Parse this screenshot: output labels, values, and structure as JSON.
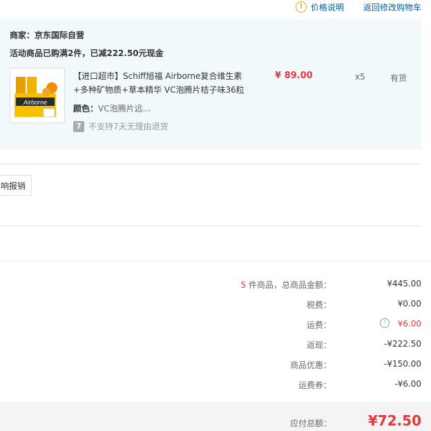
{
  "top": {
    "price_help": "价格说明",
    "back_to_cart": "返回修改购物车"
  },
  "shop": {
    "merchant": "商家：京东国际自营",
    "promo": "活动商品已购满2件，已减222.50元现金",
    "product": {
      "title": "【进口超市】Schiff旭福 Airborne复合维生素+多种矿物质+草本精华 VC泡腾片桔子味36粒",
      "price": "¥ 89.00",
      "qty": "x5",
      "stock": "有货",
      "color_label": "颜色：",
      "color_value": "VC泡腾片远...",
      "thumb_text": "Airborne",
      "return_badge": "7",
      "return_note": "不支持7天无理由退货"
    }
  },
  "buttons": {
    "report": "响报销"
  },
  "summary": {
    "count": "5",
    "goods_total_label": " 件商品，总商品金额：",
    "goods_total_value": "¥445.00",
    "tax_label": "税费：",
    "tax_value": "¥0.00",
    "shipping_label": "运费：",
    "shipping_value": "¥6.00",
    "rebate_label": "返现：",
    "rebate_value": "-¥222.50",
    "discount_label": "商品优惠：",
    "discount_value": "-¥150.00",
    "shipping_coupon_label": "运费券：",
    "shipping_coupon_value": "-¥6.00",
    "payable_label": "应付总额：",
    "payable_value": "¥72.50"
  },
  "colors": {
    "accent_red": "#e4393c",
    "link_blue": "#005ea7",
    "panel_bg": "#f2f9fd"
  }
}
